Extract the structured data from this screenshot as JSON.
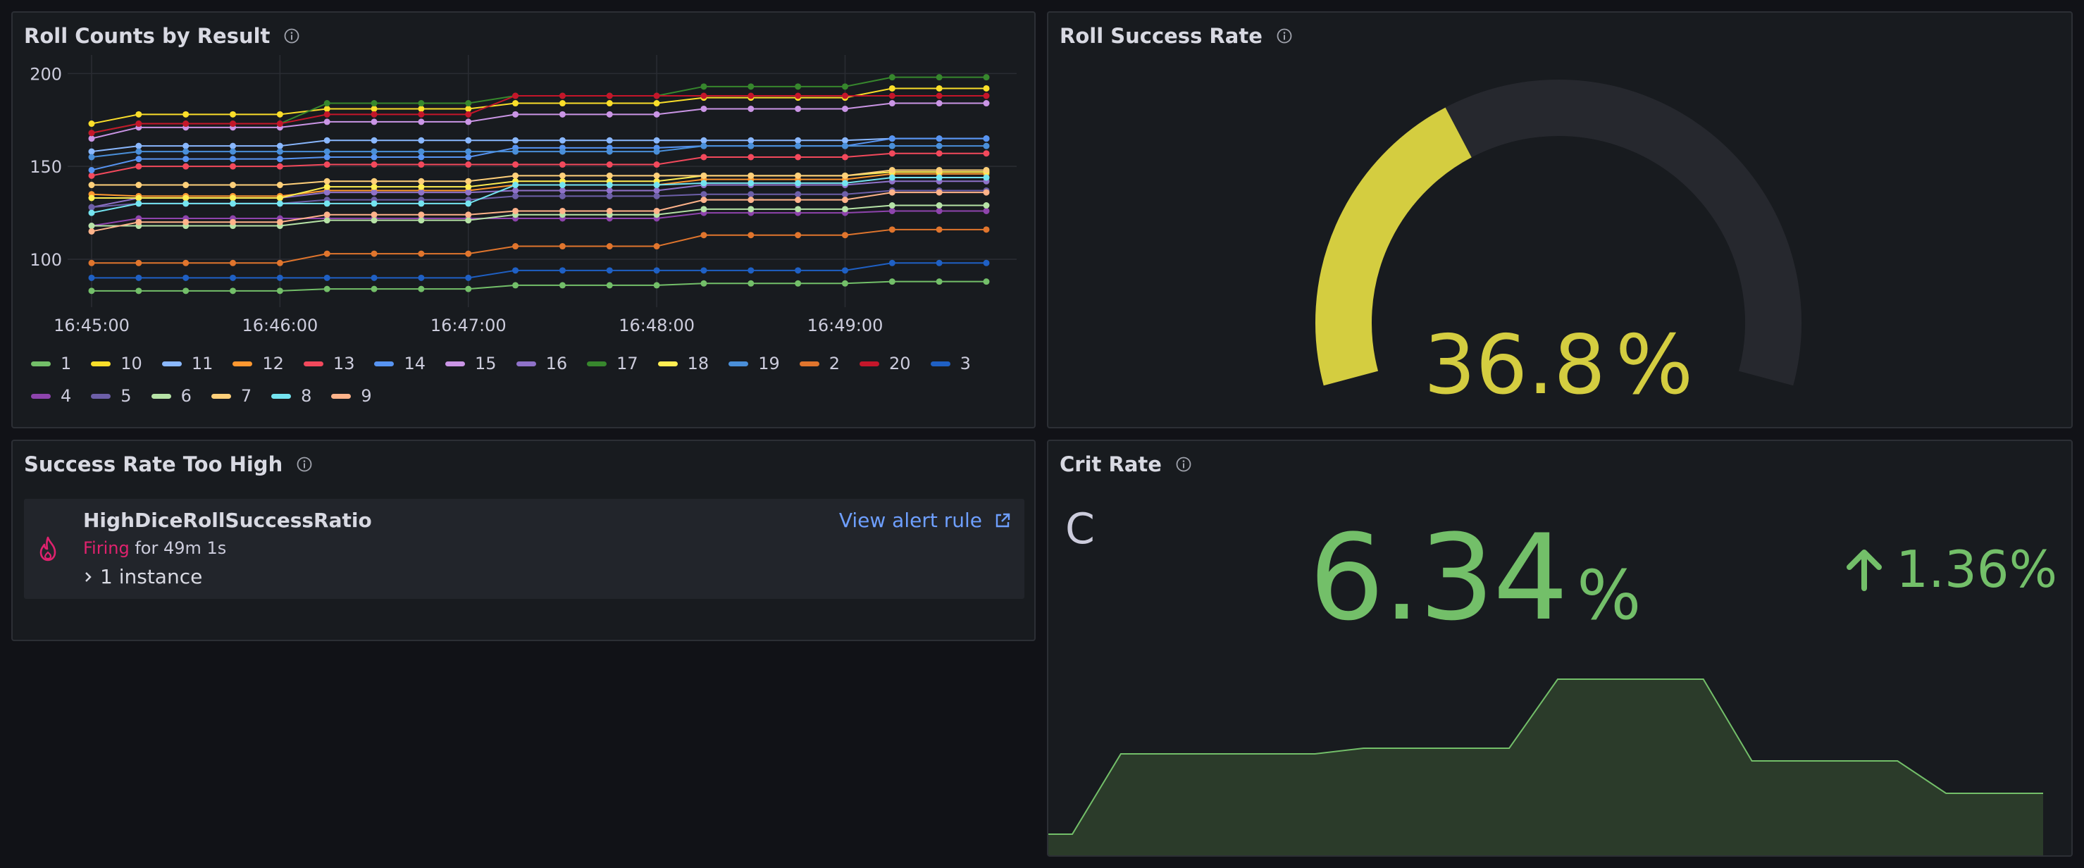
{
  "panels": {
    "roll_counts": {
      "title": "Roll Counts by Result"
    },
    "success_rate": {
      "title": "Roll Success Rate",
      "value": "36.8",
      "unit": "%",
      "fraction": 0.368
    },
    "alert": {
      "title": "Success Rate Too High",
      "rule_name": "HighDiceRollSuccessRatio",
      "state": "Firing",
      "duration": "for 49m 1s",
      "instances": "1 instance",
      "link_label": "View alert rule"
    },
    "crit_rate": {
      "title": "Crit Rate",
      "letter": "C",
      "value": "6.34",
      "unit": "%",
      "delta": "1.36%"
    }
  },
  "chart_data": [
    {
      "type": "line",
      "title": "Roll Counts by Result",
      "x": [
        "16:45:00",
        "16:45:15",
        "16:45:30",
        "16:45:45",
        "16:46:00",
        "16:46:15",
        "16:46:30",
        "16:46:45",
        "16:47:00",
        "16:47:15",
        "16:47:30",
        "16:47:45",
        "16:48:00",
        "16:48:15",
        "16:48:30",
        "16:48:45",
        "16:49:00",
        "16:49:15",
        "16:49:30",
        "16:49:45"
      ],
      "x_ticks": [
        "16:45:00",
        "16:46:00",
        "16:47:00",
        "16:48:00",
        "16:49:00"
      ],
      "y_ticks": [
        100,
        150,
        200
      ],
      "ylim": [
        78,
        210
      ],
      "grid": true,
      "legend_placement": "bottom",
      "series": [
        {
          "name": "1",
          "color": "#73bf69",
          "values": [
            83,
            83,
            83,
            83,
            83,
            84,
            84,
            84,
            84,
            86,
            86,
            86,
            86,
            87,
            87,
            87,
            87,
            88,
            88,
            88
          ]
        },
        {
          "name": "10",
          "color": "#fade2a",
          "values": [
            173,
            178,
            178,
            178,
            178,
            181,
            181,
            181,
            181,
            184,
            184,
            184,
            184,
            187,
            187,
            187,
            187,
            192,
            192,
            192
          ]
        },
        {
          "name": "11",
          "color": "#8ab8ff",
          "values": [
            158,
            161,
            161,
            161,
            161,
            164,
            164,
            164,
            164,
            164,
            164,
            164,
            164,
            164,
            164,
            164,
            164,
            165,
            165,
            165
          ]
        },
        {
          "name": "12",
          "color": "#ff9830",
          "values": [
            135,
            134,
            134,
            134,
            134,
            137,
            137,
            137,
            137,
            140,
            140,
            140,
            140,
            143,
            143,
            143,
            143,
            146,
            146,
            146
          ]
        },
        {
          "name": "13",
          "color": "#f2495c",
          "values": [
            145,
            150,
            150,
            150,
            150,
            151,
            151,
            151,
            151,
            151,
            151,
            151,
            151,
            155,
            155,
            155,
            155,
            157,
            157,
            157
          ]
        },
        {
          "name": "14",
          "color": "#5794f2",
          "values": [
            148,
            154,
            154,
            154,
            154,
            155,
            155,
            155,
            155,
            160,
            160,
            160,
            160,
            161,
            161,
            161,
            161,
            165,
            165,
            165
          ]
        },
        {
          "name": "15",
          "color": "#ca95e5",
          "values": [
            165,
            171,
            171,
            171,
            171,
            174,
            174,
            174,
            174,
            178,
            178,
            178,
            178,
            181,
            181,
            181,
            181,
            184,
            184,
            184
          ]
        },
        {
          "name": "16",
          "color": "#8f72c9",
          "values": [
            128,
            133,
            133,
            133,
            133,
            136,
            136,
            136,
            136,
            137,
            137,
            137,
            137,
            140,
            140,
            140,
            140,
            142,
            142,
            142
          ]
        },
        {
          "name": "17",
          "color": "#37872d",
          "values": [
            168,
            173,
            173,
            173,
            173,
            184,
            184,
            184,
            184,
            188,
            188,
            188,
            188,
            193,
            193,
            193,
            193,
            198,
            198,
            198
          ]
        },
        {
          "name": "18",
          "color": "#ffee52",
          "values": [
            133,
            133,
            133,
            133,
            133,
            139,
            139,
            139,
            139,
            142,
            142,
            142,
            142,
            145,
            145,
            145,
            145,
            147,
            147,
            147
          ]
        },
        {
          "name": "19",
          "color": "#4a8fd9",
          "values": [
            155,
            158,
            158,
            158,
            158,
            158,
            158,
            158,
            158,
            158,
            158,
            158,
            158,
            161,
            161,
            161,
            161,
            161,
            161,
            161
          ]
        },
        {
          "name": "2",
          "color": "#e0752d",
          "values": [
            98,
            98,
            98,
            98,
            98,
            103,
            103,
            103,
            103,
            107,
            107,
            107,
            107,
            113,
            113,
            113,
            113,
            116,
            116,
            116
          ]
        },
        {
          "name": "20",
          "color": "#c4162a",
          "values": [
            168,
            173,
            173,
            173,
            173,
            178,
            178,
            178,
            178,
            188,
            188,
            188,
            188,
            188,
            188,
            188,
            188,
            188,
            188,
            188
          ]
        },
        {
          "name": "3",
          "color": "#1f60c4",
          "values": [
            90,
            90,
            90,
            90,
            90,
            90,
            90,
            90,
            90,
            94,
            94,
            94,
            94,
            94,
            94,
            94,
            94,
            98,
            98,
            98
          ]
        },
        {
          "name": "4",
          "color": "#8e44ad",
          "values": [
            118,
            122,
            122,
            122,
            122,
            122,
            122,
            122,
            122,
            122,
            122,
            122,
            122,
            125,
            125,
            125,
            125,
            126,
            126,
            126
          ]
        },
        {
          "name": "5",
          "color": "#6d5fa8",
          "values": [
            128,
            130,
            130,
            130,
            130,
            132,
            132,
            132,
            132,
            134,
            134,
            134,
            134,
            135,
            135,
            135,
            135,
            137,
            137,
            137
          ]
        },
        {
          "name": "6",
          "color": "#b6e3a6",
          "values": [
            118,
            118,
            118,
            118,
            118,
            121,
            121,
            121,
            121,
            124,
            124,
            124,
            124,
            127,
            127,
            127,
            127,
            129,
            129,
            129
          ]
        },
        {
          "name": "7",
          "color": "#ffd07a",
          "values": [
            140,
            140,
            140,
            140,
            140,
            142,
            142,
            142,
            142,
            145,
            145,
            145,
            145,
            145,
            145,
            145,
            145,
            148,
            148,
            148
          ]
        },
        {
          "name": "8",
          "color": "#74e4f0",
          "values": [
            125,
            130,
            130,
            130,
            130,
            130,
            130,
            130,
            130,
            140,
            140,
            140,
            140,
            141,
            141,
            141,
            141,
            144,
            144,
            144
          ]
        },
        {
          "name": "9",
          "color": "#ffb38a",
          "values": [
            115,
            120,
            120,
            120,
            120,
            124,
            124,
            124,
            124,
            126,
            126,
            126,
            126,
            132,
            132,
            132,
            132,
            136,
            136,
            136
          ]
        }
      ]
    },
    {
      "type": "area",
      "title": "Crit Rate",
      "values": [
        4.95,
        4.95,
        5.52,
        5.52,
        5.52,
        5.52,
        5.52,
        5.56,
        5.56,
        5.56,
        5.56,
        6.05,
        6.05,
        6.05,
        6.05,
        5.47,
        5.47,
        5.47,
        5.47,
        5.24,
        5.24,
        5.24
      ],
      "ylim": [
        4.8,
        6.4
      ],
      "color": "#73bf69",
      "fill": "#2b3b2a"
    }
  ],
  "colors": {
    "gauge": "#d4cd40",
    "gauge_track": "#26282e",
    "stat_green": "#73bf69",
    "link": "#6e9fff",
    "firing": "#e0226e"
  },
  "icons": {
    "info": "info-circle-icon",
    "alert": "flame-icon",
    "external": "external-link-icon",
    "chevron": "chevron-right-icon",
    "delta": "arrow-up-icon"
  }
}
